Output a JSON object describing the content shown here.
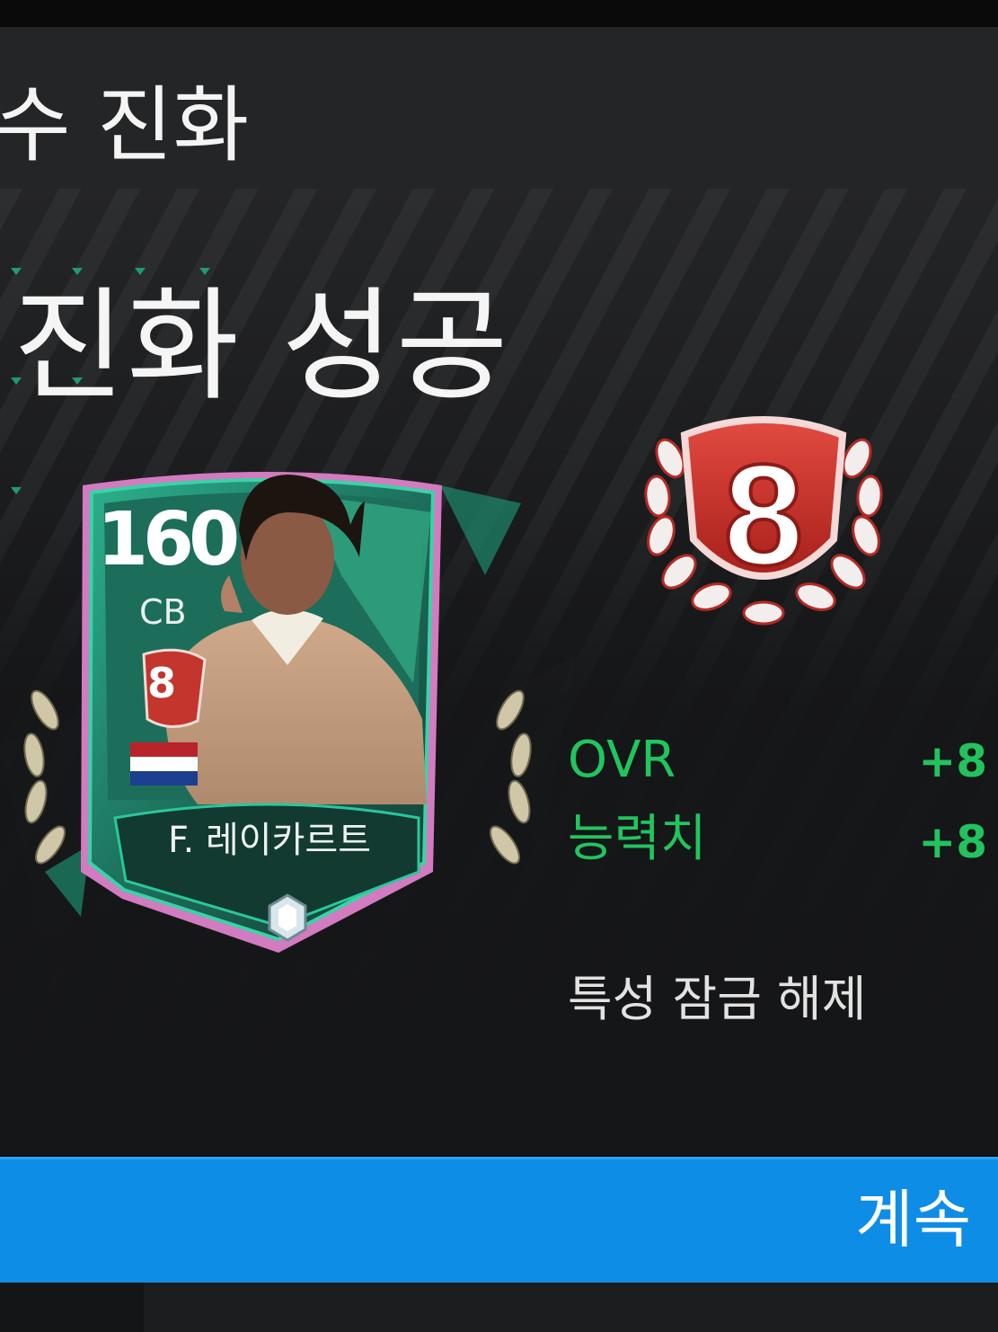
{
  "header": {
    "title": "수 진화"
  },
  "result": {
    "title": "진화 성공",
    "level": "8"
  },
  "card": {
    "rating": "160",
    "position": "CB",
    "level": "8",
    "name": "F. 레이카르트",
    "nation_flag": "netherlands-flag"
  },
  "stats": [
    {
      "label": "OVR",
      "value": "+8"
    },
    {
      "label": "능력치",
      "value": "+8"
    }
  ],
  "unlock_text": "특성 잠금 해제",
  "continue_label": "계속",
  "colors": {
    "accent_green": "#21c55e",
    "button_blue": "#0e8de6",
    "badge_red": "#c8302a",
    "card_teal": "#1f8d72"
  }
}
